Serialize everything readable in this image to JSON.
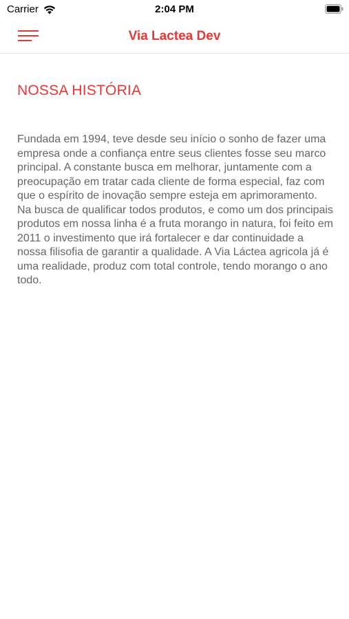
{
  "status_bar": {
    "carrier": "Carrier",
    "time": "2:04 PM",
    "wifi_icon": "wifi-icon",
    "battery_icon": "battery-icon"
  },
  "nav": {
    "title": "Via Lactea Dev",
    "menu_icon": "hamburger-menu-icon",
    "accent_color": "#e53935"
  },
  "page": {
    "heading": "NOSSA HISTÓRIA",
    "paragraph": "Fundada em 1994, teve desde seu início o sonho de fazer uma empresa onde a confiança entre seus clientes fosse seu marco principal. A constante busca em melhorar, juntamente com a preocupação em tratar cada cliente de forma especial, faz com que o espírito de inovação sempre esteja em aprimoramento. Na busca de qualificar todos produtos, e como um dos principais produtos em nossa linha é a fruta morango in natura, foi feito em 2011 o investimento que irá fortalecer e dar continuidade a nossa filisofia de garantir a qualidade. A Via Láctea agricola já é uma realidade, produz com total controle, tendo morango o ano todo.",
    "text_color": "#666666"
  }
}
